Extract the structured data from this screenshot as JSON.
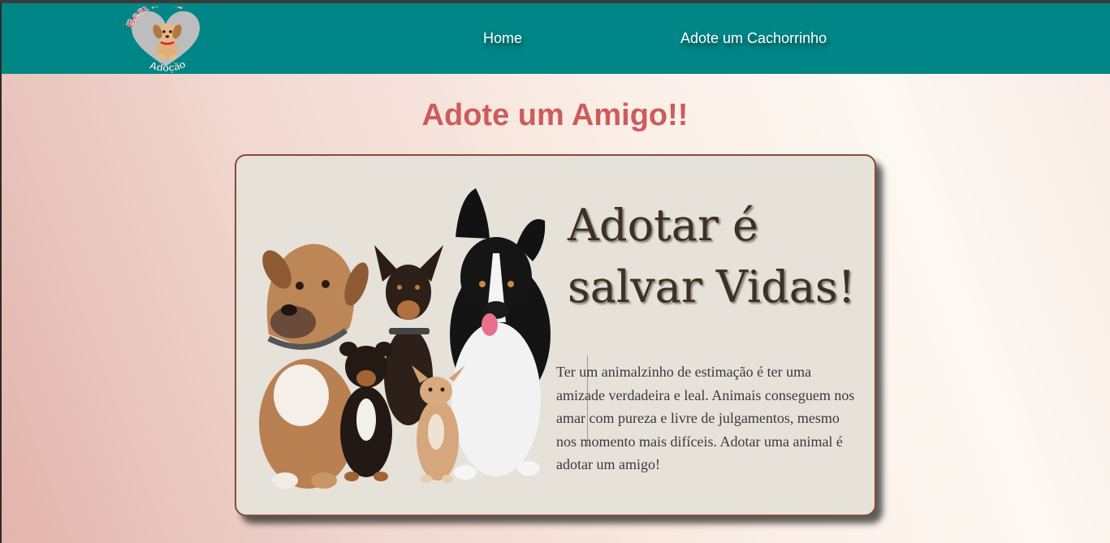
{
  "logo": {
    "top_text": "Best friend",
    "bottom_text": "Adoção"
  },
  "nav": {
    "home": "Home",
    "adote": "Adote um Cachorrinho"
  },
  "main": {
    "heading": "Adote um Amigo!!"
  },
  "card": {
    "title_line1": "Adotar é",
    "title_line2": "salvar Vidas!",
    "text": "Ter um animalzinho de estimação é ter uma amizade verdadeira e leal. Animais conseguem nos amar com pureza e livre de julgamentos, mesmo nos momento mais difíceis. Adotar uma animal é adotar um amigo!"
  },
  "colors": {
    "header": "#008686",
    "heading": "#cd5c5c",
    "card_bg": "#e6e1d9",
    "card_border": "#8a4a36"
  },
  "icons": {
    "logo": "puppy-heart-logo",
    "image": "dogs-group-photo"
  }
}
